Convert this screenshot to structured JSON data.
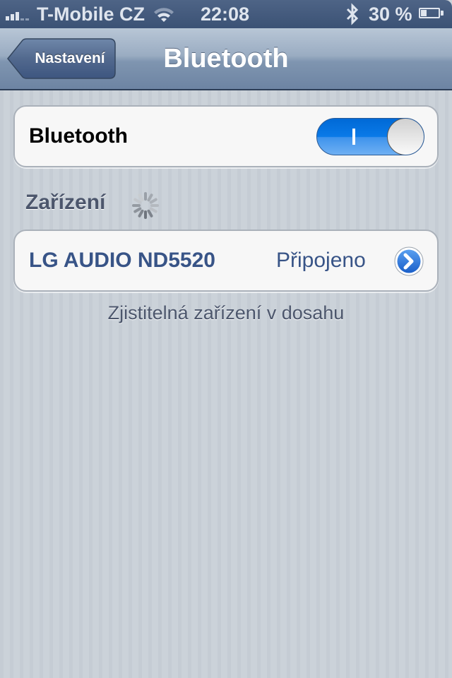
{
  "status_bar": {
    "signal_bars_filled": 3,
    "signal_bars_total": 5,
    "carrier": "T-Mobile CZ",
    "wifi_icon": "wifi-icon",
    "time": "22:08",
    "bluetooth_icon": "bluetooth-icon",
    "battery_percent": "30 %",
    "battery_level": 0.3
  },
  "nav": {
    "back_label": "Nastavení",
    "title": "Bluetooth"
  },
  "bluetooth_toggle": {
    "label": "Bluetooth",
    "on": true,
    "on_glyph": "I",
    "color": "#0a7ae8"
  },
  "devices": {
    "header": "Zařízení",
    "searching_icon": "spinner-icon",
    "items": [
      {
        "name": "LG AUDIO ND5520",
        "status": "Připojeno",
        "accessory_icon": "disclosure-icon"
      }
    ],
    "footer": "Zjistitelná zařízení v dosahu"
  }
}
